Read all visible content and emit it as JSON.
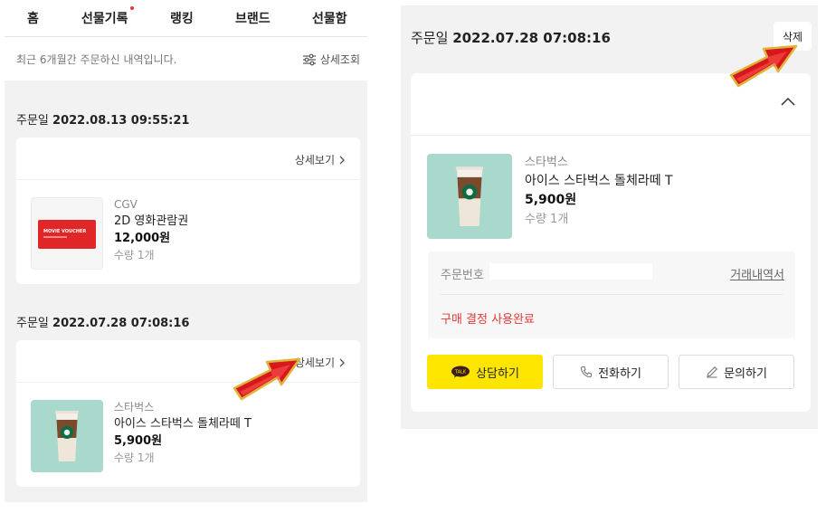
{
  "left": {
    "tabs": [
      {
        "label": "홈"
      },
      {
        "label": "선물기록"
      },
      {
        "label": "랭킹"
      },
      {
        "label": "브랜드"
      },
      {
        "label": "선물함"
      }
    ],
    "notice": "최근 6개월간 주문하신 내역입니다.",
    "filter_label": "상세조회",
    "orders": [
      {
        "date_label": "주문일",
        "date_value": "2022.08.13 09:55:21",
        "detail_label": "상세보기",
        "item": {
          "brand": "CGV",
          "name": "2D 영화관람권",
          "price": "12,000원",
          "qty": "수량 1개",
          "voucher_text": "MOVIE VOUCHER"
        }
      },
      {
        "date_label": "주문일",
        "date_value": "2022.07.28 07:08:16",
        "detail_label": "상세보기",
        "item": {
          "brand": "스타벅스",
          "name": "아이스 스타벅스 돌체라떼 T",
          "price": "5,900원",
          "qty": "수량 1개"
        }
      }
    ]
  },
  "right": {
    "date_label": "주문일",
    "date_value": "2022.07.28 07:08:16",
    "delete_label": "삭제",
    "item": {
      "brand": "스타벅스",
      "name": "아이스 스타벅스 돌체라떼 T",
      "price": "5,900원",
      "qty": "수량 1개"
    },
    "order_no_label": "주문번호",
    "receipt_label": "거래내역서",
    "status_text": "구매 결정 사용완료",
    "actions": {
      "chat": "상담하기",
      "chat_badge": "TALK",
      "call": "전화하기",
      "inquiry": "문의하기"
    }
  },
  "colors": {
    "kakao_yellow": "#fee500",
    "status_red": "#e53935",
    "arrow_red": "#d6181e",
    "arrow_gold": "#e0b43a",
    "starbucks_bg": "#a9d8cc"
  }
}
